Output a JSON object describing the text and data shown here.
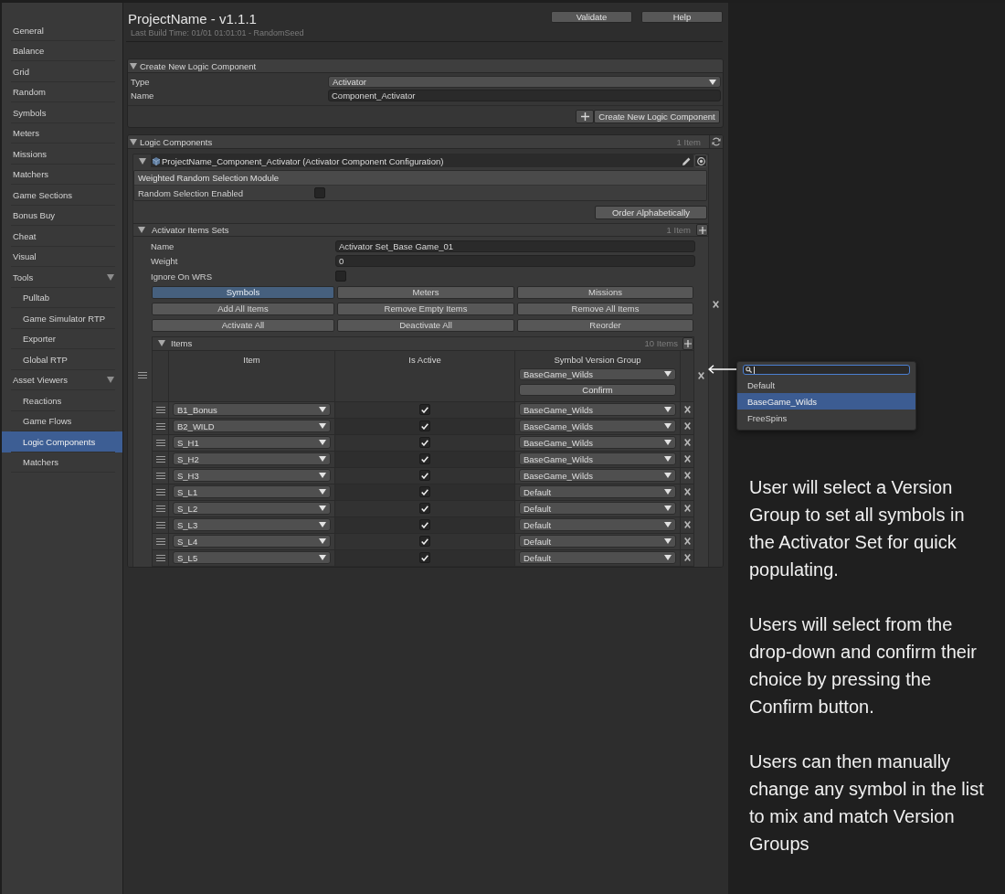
{
  "sidebar": {
    "items": [
      {
        "label": "General",
        "selected": false
      },
      {
        "label": "Balance",
        "selected": false
      },
      {
        "label": "Grid",
        "selected": false
      },
      {
        "label": "Random",
        "selected": false
      },
      {
        "label": "Symbols",
        "selected": false
      },
      {
        "label": "Meters",
        "selected": false
      },
      {
        "label": "Missions",
        "selected": false
      },
      {
        "label": "Matchers",
        "selected": false
      },
      {
        "label": "Game Sections",
        "selected": false
      },
      {
        "label": "Bonus Buy",
        "selected": false
      },
      {
        "label": "Cheat",
        "selected": false
      },
      {
        "label": "Visual",
        "selected": false
      },
      {
        "label": "Tools",
        "selected": false,
        "expanded": true,
        "children": [
          {
            "label": "Pulltab",
            "selected": false
          },
          {
            "label": "Game Simulator RTP",
            "selected": false
          },
          {
            "label": "Exporter",
            "selected": false
          },
          {
            "label": "Global RTP",
            "selected": false
          }
        ]
      },
      {
        "label": "Asset Viewers",
        "selected": false,
        "expanded": true,
        "children": [
          {
            "label": "Reactions",
            "selected": false
          },
          {
            "label": "Game Flows",
            "selected": false
          },
          {
            "label": "Logic Components",
            "selected": true
          },
          {
            "label": "Matchers",
            "selected": false
          }
        ]
      }
    ]
  },
  "header": {
    "title": "ProjectName - v1.1.1",
    "subtitle": "Last Build Time: 01/01 01:01:01 - RandomSeed",
    "buttons": [
      "Validate",
      "Help"
    ]
  },
  "create_panel": {
    "title": "Create New Logic Component",
    "expanded": true,
    "fields": [
      {
        "kind": "dropdown",
        "label": "Type",
        "value": "Activator"
      },
      {
        "kind": "text",
        "label": "Name",
        "value": "Component_Activator"
      }
    ],
    "button": "Create New Logic Component"
  },
  "logic_components": {
    "title": "Logic Components",
    "count": "1 Item",
    "expanded": true,
    "component": {
      "title": "ProjectName_Component_Activator (Activator Component Configuration)",
      "expanded": true,
      "module": {
        "title": "Weighted Random Selection Module",
        "label": "Random Selection Enabled",
        "checked": false
      },
      "order_button": "Order Alphabetically",
      "item_sets": {
        "title": "Activator Items Sets",
        "count": "1 Item",
        "expanded": true,
        "fields": [
          {
            "kind": "text",
            "label": "Name",
            "value": "Activator Set_Base Game_01"
          },
          {
            "kind": "text",
            "label": "Weight",
            "value": "0"
          },
          {
            "kind": "checkbox",
            "label": "Ignore On WRS",
            "checked": false
          }
        ],
        "tabs": [
          {
            "label": "Symbols",
            "selected": true
          },
          {
            "label": "Meters",
            "selected": false
          },
          {
            "label": "Missions",
            "selected": false
          }
        ],
        "actions": [
          "Add All Items",
          "Remove Empty Items",
          "Remove All Items",
          "Activate All",
          "Deactivate All",
          "Reorder"
        ],
        "items": {
          "title": "Items",
          "count": "10 Items",
          "expanded": true,
          "columns": [
            "Item",
            "Is Active",
            "Symbol Version Group"
          ],
          "group_value": "BaseGame_Wilds",
          "confirm_button": "Confirm",
          "rows": [
            {
              "item": "B1_Bonus",
              "active": true,
              "group": "BaseGame_Wilds"
            },
            {
              "item": "B2_WILD",
              "active": true,
              "group": "BaseGame_Wilds"
            },
            {
              "item": "S_H1",
              "active": true,
              "group": "BaseGame_Wilds"
            },
            {
              "item": "S_H2",
              "active": true,
              "group": "BaseGame_Wilds"
            },
            {
              "item": "S_H3",
              "active": true,
              "group": "BaseGame_Wilds"
            },
            {
              "item": "S_L1",
              "active": true,
              "group": "Default"
            },
            {
              "item": "S_L2",
              "active": true,
              "group": "Default"
            },
            {
              "item": "S_L3",
              "active": true,
              "group": "Default"
            },
            {
              "item": "S_L4",
              "active": true,
              "group": "Default"
            },
            {
              "item": "S_L5",
              "active": true,
              "group": "Default"
            }
          ]
        }
      }
    }
  },
  "popup": {
    "options": [
      {
        "label": "Default",
        "selected": false
      },
      {
        "label": "BaseGame_Wilds",
        "selected": true
      },
      {
        "label": "FreeSpins",
        "selected": false
      }
    ]
  },
  "annotation": {
    "paragraphs": [
      "User will select a Version Group to set all symbols in the Activator Set for quick populating.",
      "Users will select from the drop-down and confirm their choice by pressing the Confirm button.",
      "Users can then manually change any symbol in the list to mix and match Version Groups"
    ]
  }
}
